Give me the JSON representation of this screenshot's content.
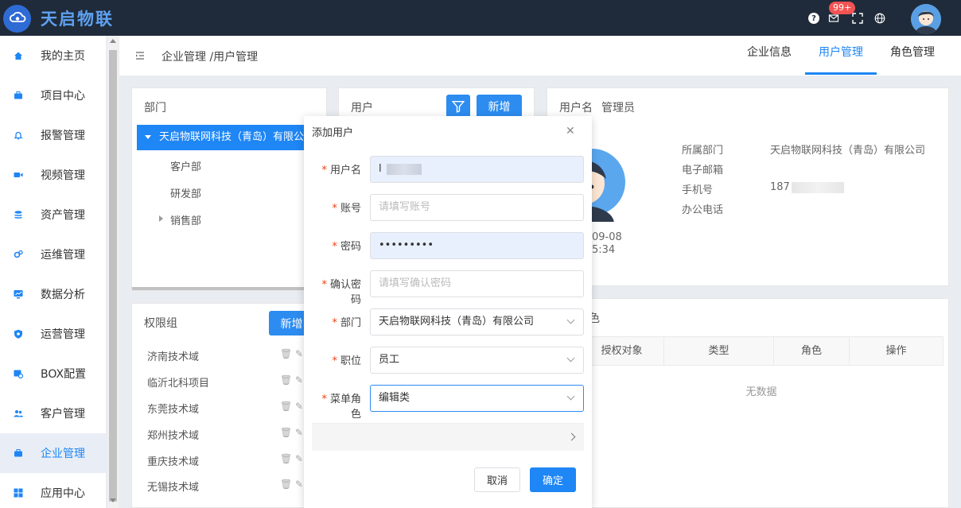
{
  "app": {
    "brand": "天启物联"
  },
  "topbar": {
    "help_icon": "question-circle-icon",
    "mail_icon": "mail-icon",
    "mail_badge": "99+",
    "fullscreen_icon": "expand-icon",
    "language_icon": "globe-icon"
  },
  "sidebar": {
    "items": [
      {
        "label": "我的主页",
        "icon": "home-icon"
      },
      {
        "label": "项目中心",
        "icon": "briefcase-icon"
      },
      {
        "label": "报警管理",
        "icon": "bell-icon"
      },
      {
        "label": "视频管理",
        "icon": "video-icon"
      },
      {
        "label": "资产管理",
        "icon": "stack-icon"
      },
      {
        "label": "运维管理",
        "icon": "gears-icon"
      },
      {
        "label": "数据分析",
        "icon": "monitor-chart-icon"
      },
      {
        "label": "运营管理",
        "icon": "shield-icon"
      },
      {
        "label": "BOX配置",
        "icon": "box-settings-icon"
      },
      {
        "label": "客户管理",
        "icon": "users-icon"
      },
      {
        "label": "企业管理",
        "icon": "briefcase-icon"
      },
      {
        "label": "应用中心",
        "icon": "apps-grid-icon"
      }
    ],
    "active_index": 10
  },
  "header": {
    "breadcrumb": "企业管理 /用户管理",
    "tabs": [
      {
        "label": "企业信息"
      },
      {
        "label": "用户管理"
      },
      {
        "label": "角色管理"
      }
    ]
  },
  "dept_panel": {
    "title": "部门",
    "root": "天启物联网科技（青岛）有限公司",
    "children": [
      "客户部",
      "研发部",
      "销售部"
    ]
  },
  "user_panel": {
    "title": "用户",
    "add_button": "新增"
  },
  "perm_panel": {
    "title": "权限组",
    "add_button": "新增",
    "items": [
      "济南技术域",
      "临沂北科项目",
      "东莞技术域",
      "郑州技术域",
      "重庆技术域",
      "无锡技术域"
    ]
  },
  "user_info": {
    "username_label": "用户名",
    "username": "管理员",
    "fields": [
      {
        "label": "所属部门",
        "value": "天启物联网科技（青岛）有限公司"
      },
      {
        "label": "电子邮箱",
        "value": ""
      },
      {
        "label": "手机号",
        "value": "187"
      },
      {
        "label": "办公电话",
        "value": ""
      }
    ],
    "date_partial": "09-08",
    "time_partial": "5:34"
  },
  "role_panel": {
    "title_partial": "色",
    "columns": [
      "授权对象",
      "类型",
      "角色",
      "操作"
    ],
    "empty_text": "无数据"
  },
  "modal": {
    "title": "添加用户",
    "close_icon": "close-icon",
    "fields": [
      {
        "label": "用户名",
        "value": "l",
        "placeholder": ""
      },
      {
        "label": "账号",
        "value": "",
        "placeholder": "请填写账号"
      },
      {
        "label": "密码",
        "value": "•••••••••",
        "placeholder": ""
      },
      {
        "label": "确认密码",
        "value": "",
        "placeholder": "请填写确认密码"
      },
      {
        "label": "部门",
        "value": "天启物联网科技（青岛）有限公司"
      },
      {
        "label": "职位",
        "value": "员工"
      },
      {
        "label": "菜单角色",
        "value": "编辑类"
      }
    ],
    "cancel": "取消",
    "confirm": "确定"
  },
  "colors": {
    "accent": "#1e86f5",
    "topbar": "#1f2b3a",
    "danger": "#ed4014",
    "badge": "#f35353"
  }
}
